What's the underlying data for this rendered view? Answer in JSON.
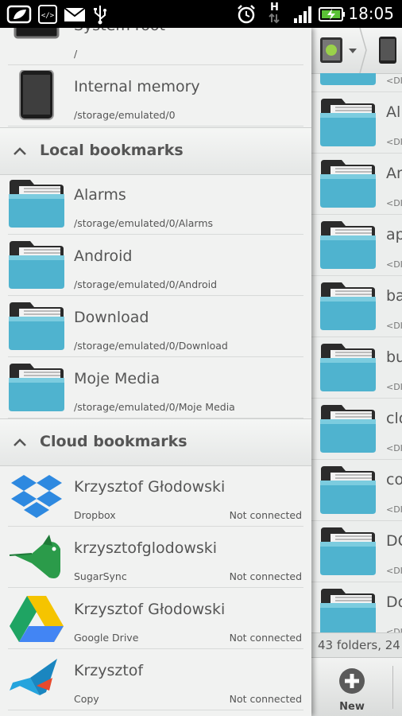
{
  "status_bar": {
    "time": "18:05",
    "network": "H",
    "icons": [
      "leaf-icon",
      "code-icon",
      "mail-icon",
      "usb-icon",
      "alarm-icon",
      "signal-icon",
      "battery-charging-icon"
    ]
  },
  "drawer": {
    "storage": [
      {
        "title": "System root",
        "path": "/",
        "icon": "terminal-icon"
      },
      {
        "title": "Internal memory",
        "path": "/storage/emulated/0",
        "icon": "phone-icon"
      }
    ],
    "local_section": "Local bookmarks",
    "local_bookmarks": [
      {
        "title": "Alarms",
        "path": "/storage/emulated/0/Alarms",
        "icon": "folder-icon"
      },
      {
        "title": "Android",
        "path": "/storage/emulated/0/Android",
        "icon": "folder-icon"
      },
      {
        "title": "Download",
        "path": "/storage/emulated/0/Download",
        "icon": "folder-icon"
      },
      {
        "title": "Moje Media",
        "path": "/storage/emulated/0/Moje Media",
        "icon": "folder-icon"
      }
    ],
    "cloud_section": "Cloud bookmarks",
    "cloud_bookmarks": [
      {
        "title": "Krzysztof Głodowski",
        "service": "Dropbox",
        "status": "Not connected",
        "icon": "dropbox-icon"
      },
      {
        "title": "krzysztofglodowski",
        "service": "SugarSync",
        "status": "Not connected",
        "icon": "sugarsync-icon"
      },
      {
        "title": "Krzysztof Głodowski",
        "service": "Google Drive",
        "status": "Not connected",
        "icon": "google-drive-icon"
      },
      {
        "title": "Krzysztof",
        "service": "Copy",
        "status": "Not connected",
        "icon": "copy-icon"
      }
    ]
  },
  "file_list": {
    "items": [
      {
        "name": "",
        "meta": "<DI"
      },
      {
        "name": "All",
        "meta": "<DI"
      },
      {
        "name": "An",
        "meta": "<DI"
      },
      {
        "name": "ap",
        "meta": "<DI"
      },
      {
        "name": "ba",
        "meta": "<DI"
      },
      {
        "name": "bu",
        "meta": "<DI"
      },
      {
        "name": "clo",
        "meta": "<DI"
      },
      {
        "name": "co",
        "meta": "<DI"
      },
      {
        "name": "DC",
        "meta": "<DI"
      },
      {
        "name": "Do",
        "meta": "<DI"
      }
    ],
    "summary": "43 folders, 24",
    "new_label": "New"
  },
  "colors": {
    "folder_body": "#4fb3cf",
    "folder_dark": "#2b2b2b",
    "drawer_bg": "#f1f2f1"
  }
}
